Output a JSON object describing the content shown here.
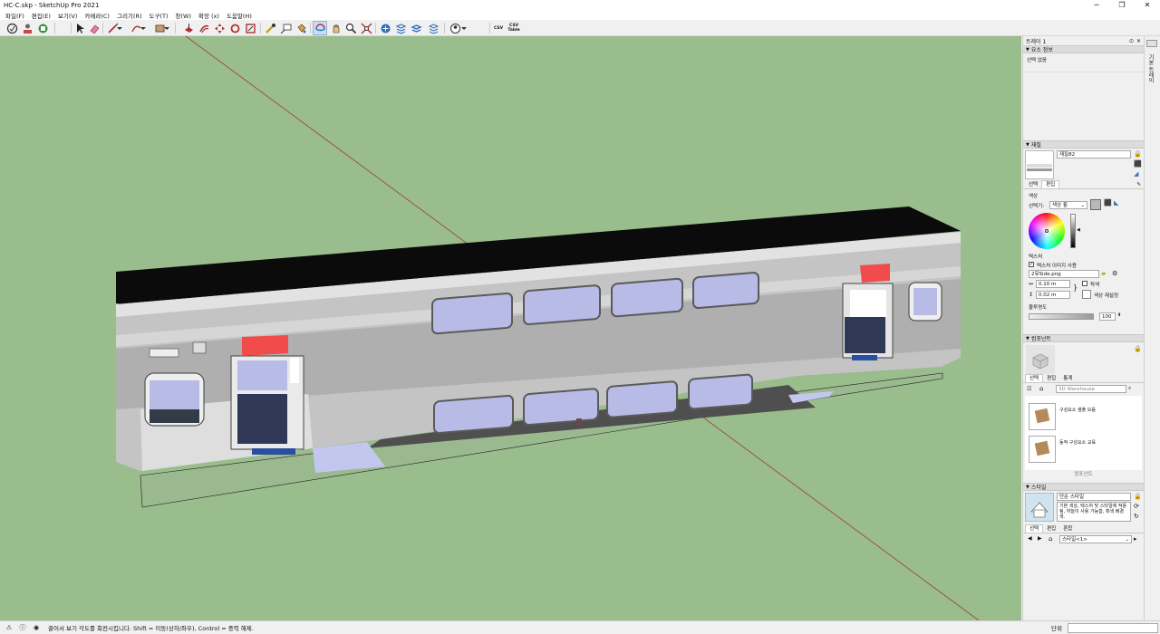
{
  "window": {
    "title": "HC-C.skp - SketchUp Pro 2021",
    "minimize": "─",
    "maximize": "❐",
    "close": "✕"
  },
  "menu": [
    "파일(F)",
    "편집(E)",
    "보기(V)",
    "카메라(C)",
    "그리기(R)",
    "도구(T)",
    "창(W)",
    "확장 (x)",
    "도움말(H)"
  ],
  "toolbar": {
    "csv": "CSV",
    "csv_table_top": "CSV",
    "csv_table_bottom": "Table"
  },
  "tray": {
    "title": "트레이 1",
    "entity_info": {
      "header": "요소 정보",
      "selection": "선택 없음"
    },
    "materials": {
      "header": "재질",
      "name": "재질82",
      "tab_select": "선택",
      "tab_edit": "편집",
      "color_label": "색상",
      "picker_label": "선택기:",
      "picker_value": "색상 휠",
      "texture_label": "텍스처",
      "use_texture": "텍스처 이미지 사용",
      "texture_file": "2뮤Side.png",
      "width": "0.10 m",
      "height": "0.02 m",
      "colorize": "착색",
      "reset_color": "색상 재설정",
      "opacity_label": "불투명도",
      "opacity_value": "100",
      "colors": {
        "swatch": "#b8b8b8"
      }
    },
    "components": {
      "header": "컴포넌트",
      "tab_select": "선택",
      "tab_edit": "편집",
      "tab_stats": "통계",
      "search_placeholder": "3D Warehouse",
      "items": [
        {
          "label": "구성요소 샘플 모음"
        },
        {
          "label": "동적 구성요소 교육"
        }
      ],
      "footer": "컴포넌트"
    },
    "styles": {
      "header": "스타일",
      "title": "단순 스타일",
      "description": "기본 색상, 텍스처 및 스타일에 적용됨, 하늘이 사용 가능함, 흑색 배경색.",
      "tab_select": "선택",
      "tab_edit": "편집",
      "tab_mix": "혼합",
      "style_name": "스타일<1>"
    }
  },
  "side_tab": "기본 트레이",
  "status": {
    "text": "끌어서 보기 각도를 회전시킵니다. Shift = 이동(상하/좌우), Control = 중력 해제.",
    "measure_label": "단위"
  },
  "colors": {
    "viewport_bg": "#99bd8c",
    "accent": "#c9def5"
  }
}
